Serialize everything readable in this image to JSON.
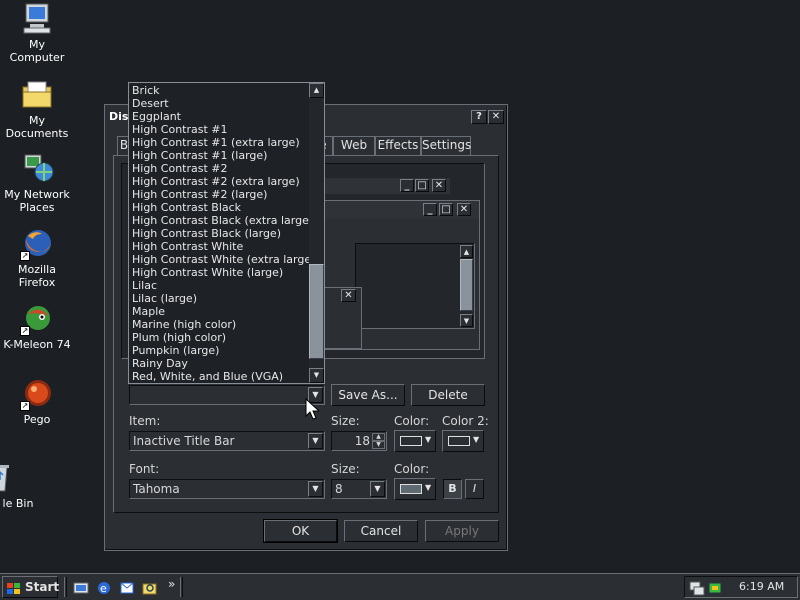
{
  "desktop": {
    "icons": [
      {
        "label": "My Computer"
      },
      {
        "label": "My Documents"
      },
      {
        "label": "My Network Places"
      },
      {
        "label": "Mozilla Firefox"
      },
      {
        "label": "K-Meleon 74"
      },
      {
        "label": "Pego"
      },
      {
        "label": "Recycle Bin",
        "visible_label": "le Bin"
      }
    ]
  },
  "dialog": {
    "title": "Disp",
    "help_glyph": "?",
    "close_glyph": "✕",
    "tabs": [
      "B",
      "e",
      "Web",
      "Effects",
      "Settings"
    ],
    "preview": {
      "min_glyph": "_",
      "max_glyph": "□",
      "close_glyph": "✕"
    },
    "scheme_list": {
      "items": [
        "Brick",
        "Desert",
        "Eggplant",
        "High Contrast #1",
        "High Contrast #1 (extra large)",
        "High Contrast #1 (large)",
        "High Contrast #2",
        "High Contrast #2 (extra large)",
        "High Contrast #2 (large)",
        "High Contrast Black",
        "High Contrast Black (extra large)",
        "High Contrast Black (large)",
        "High Contrast White",
        "High Contrast White (extra large)",
        "High Contrast White (large)",
        "Lilac",
        "Lilac (large)",
        "Maple",
        "Marine (high color)",
        "Plum (high color)",
        "Pumpkin (large)",
        "Rainy Day",
        "Red, White, and Blue (VGA)"
      ],
      "scroll_fraction": 0.95
    },
    "save_as_label": "Save As...",
    "delete_label": "Delete",
    "item_label": "Item:",
    "item_value": "Inactive Title Bar",
    "size_label": "Size:",
    "item_size_value": "18",
    "color_label": "Color:",
    "color2_label": "Color 2:",
    "font_label": "Font:",
    "font_value": "Tahoma",
    "font_size_label": "Size:",
    "font_size_value": "8",
    "font_color_label": "Color:",
    "bold_label": "B",
    "italic_label": "I",
    "ok_label": "OK",
    "cancel_label": "Cancel",
    "apply_label": "Apply",
    "colors": {
      "item_color": "#2b2e33",
      "item_color2": "#2b2e33",
      "font_color": "#5f6a73"
    }
  },
  "taskbar": {
    "start_label": "Start",
    "chevron": "»",
    "clock": "6:19 AM"
  }
}
